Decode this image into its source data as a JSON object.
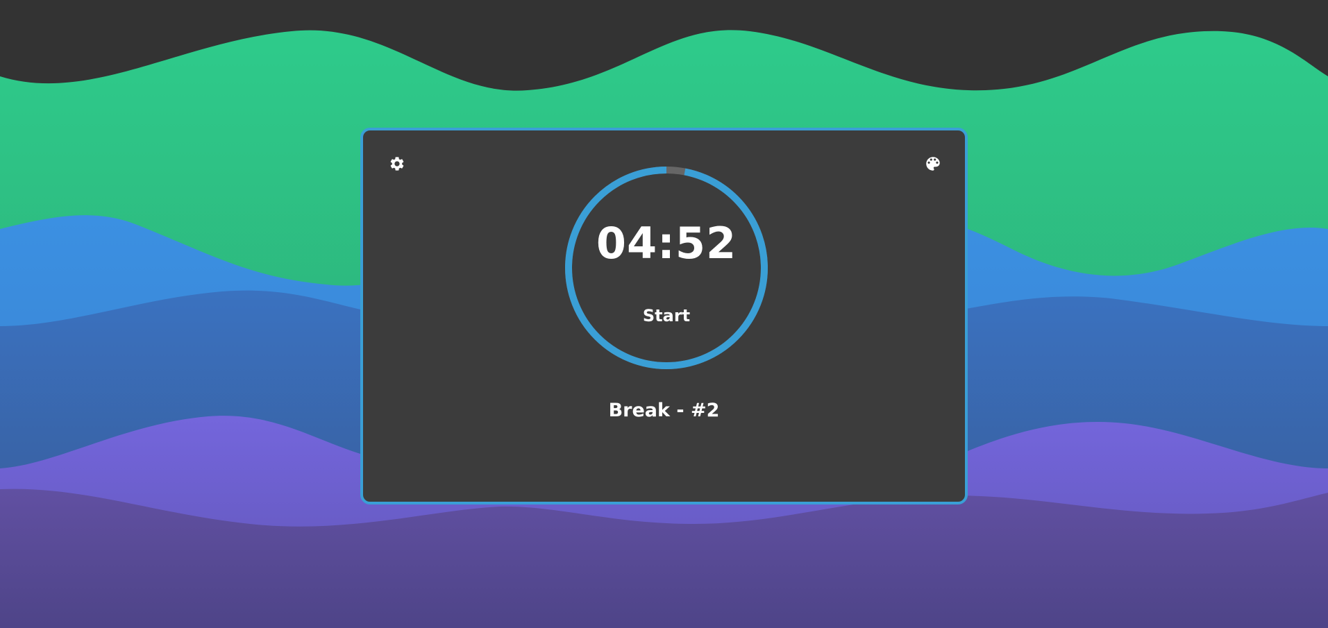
{
  "timer": {
    "display": "04:52",
    "start_label": "Start",
    "progress_fraction": 0.97
  },
  "session": {
    "label": "Break - #2"
  },
  "toolbar": {
    "settings_icon": "gear-icon",
    "theme_icon": "palette-icon"
  },
  "theme": {
    "accent": "#3a9fd6",
    "card_bg": "#3c3c3c",
    "page_bg": "#333333",
    "track": "#666666",
    "text": "#ffffff",
    "wave_colors": [
      "#2ec98a",
      "#3b8fe0",
      "#3a6db8",
      "#7466d8",
      "#5a4a94"
    ]
  }
}
